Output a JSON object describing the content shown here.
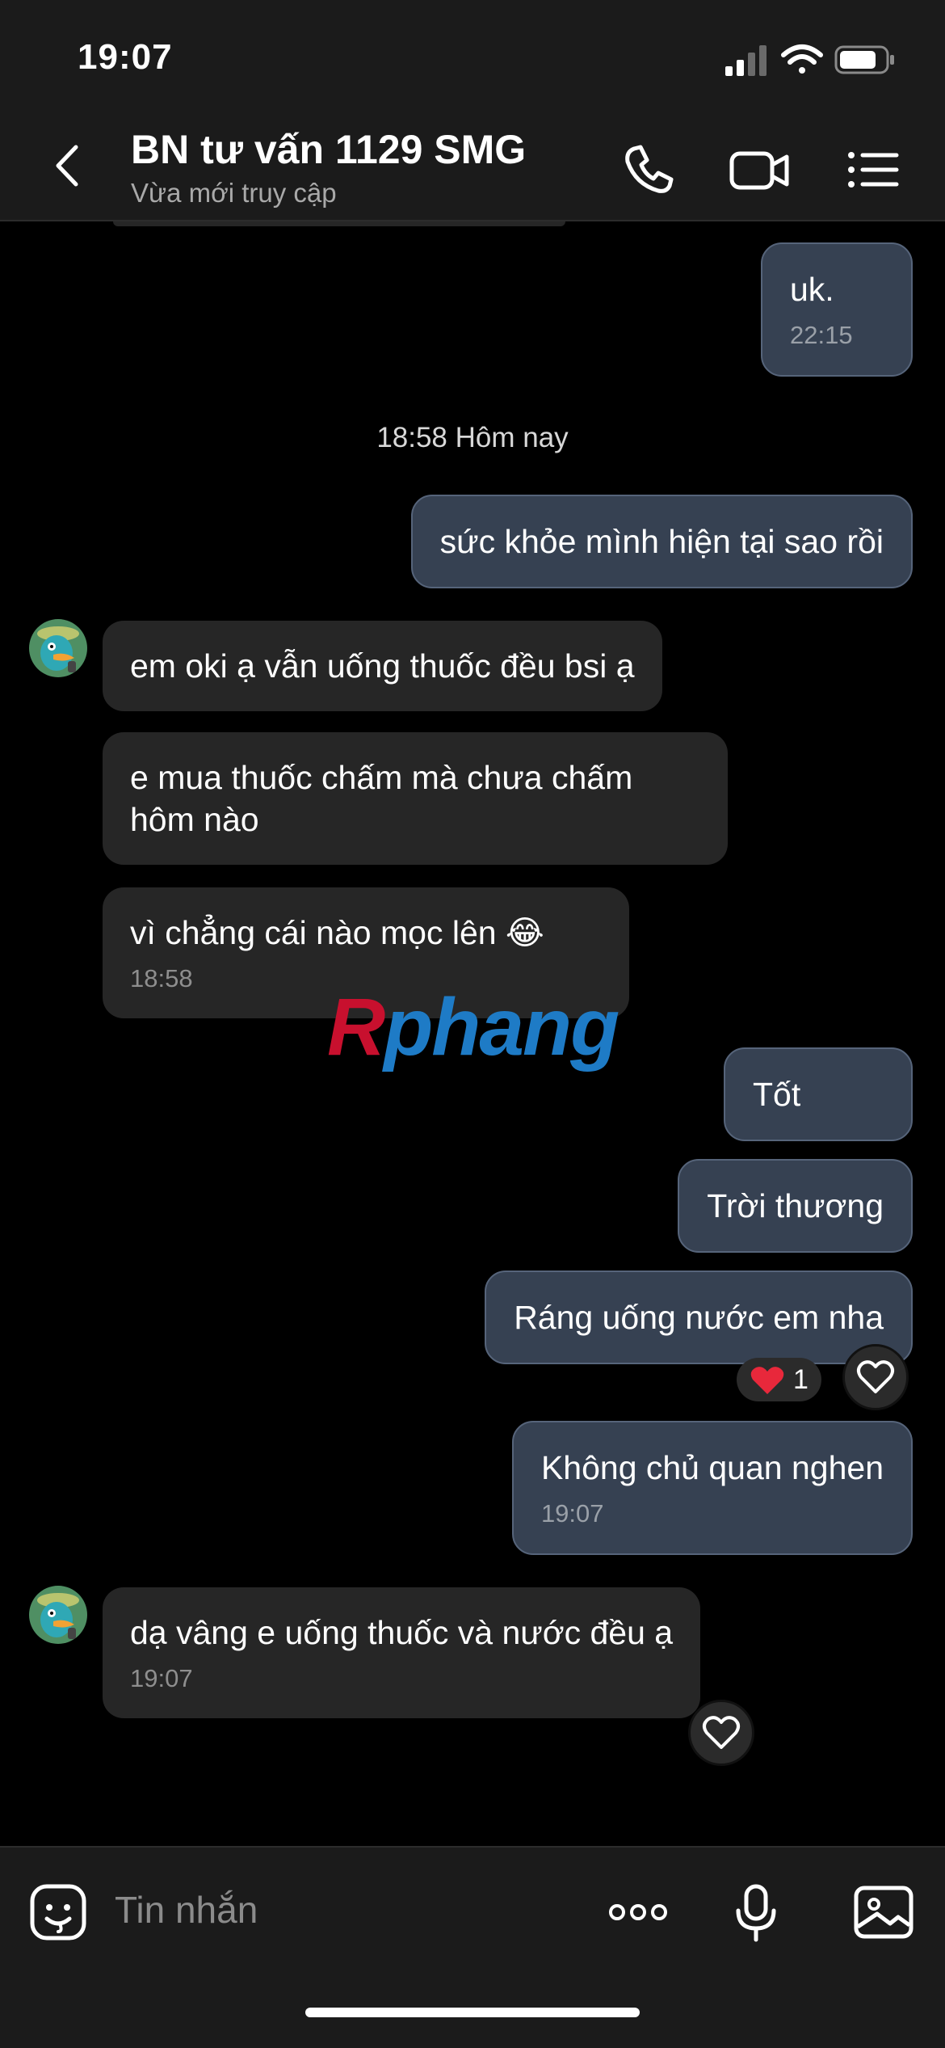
{
  "status_bar": {
    "time": "19:07"
  },
  "header": {
    "title": "BN tư vấn 1129 SMG",
    "subtitle": "Vừa mới truy cập"
  },
  "messages": {
    "date_separator": "18:58 Hôm nay",
    "items": [
      {
        "direction": "out",
        "text": "uk.",
        "time": "22:15"
      },
      {
        "direction": "out",
        "text": "sức khỏe mình hiện tại sao rồi"
      },
      {
        "direction": "in",
        "text": "em oki ạ vẫn uống thuốc đều bsi ạ"
      },
      {
        "direction": "in",
        "lines": [
          "e mua thuốc chấm mà chưa chấm",
          "hôm nào"
        ]
      },
      {
        "direction": "in",
        "text": "vì chẳng cái nào mọc lên 😂",
        "time": "18:58"
      },
      {
        "direction": "out",
        "text": "Tốt"
      },
      {
        "direction": "out",
        "text": "Trời thương"
      },
      {
        "direction": "out",
        "text": "Ráng uống nước em nha",
        "reaction": {
          "emoji": "❤️",
          "count": "1"
        }
      },
      {
        "direction": "out",
        "text": "Không chủ quan nghen",
        "time": "19:07"
      },
      {
        "direction": "in",
        "text": "dạ vâng e uống thuốc và nước đều ạ",
        "time": "19:07"
      }
    ]
  },
  "watermark": {
    "part1": "R",
    "part2": "phang"
  },
  "input": {
    "placeholder": "Tin nhắn"
  },
  "icons": [
    "back-icon",
    "phone-icon",
    "video-call-icon",
    "menu-list-icon",
    "heart-icon",
    "sticker-icon",
    "more-icon",
    "microphone-icon",
    "image-icon"
  ]
}
